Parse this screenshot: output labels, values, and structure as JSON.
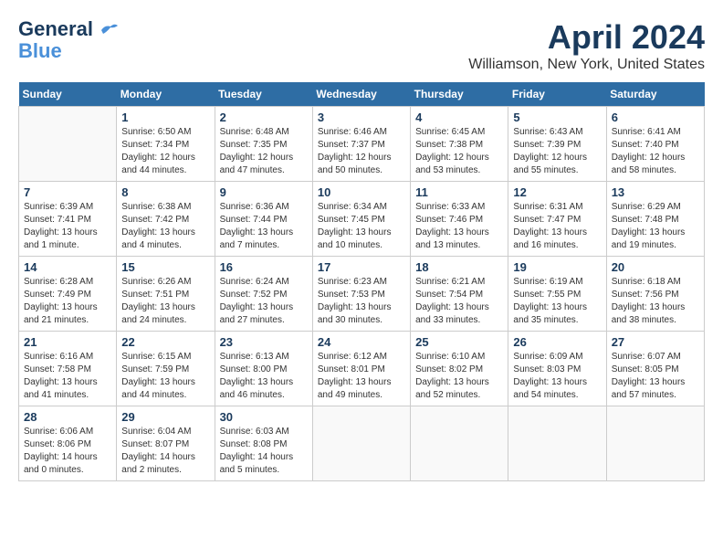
{
  "header": {
    "logo_line1": "General",
    "logo_line2": "Blue",
    "month_title": "April 2024",
    "location": "Williamson, New York, United States"
  },
  "weekdays": [
    "Sunday",
    "Monday",
    "Tuesday",
    "Wednesday",
    "Thursday",
    "Friday",
    "Saturday"
  ],
  "weeks": [
    [
      {
        "day": "",
        "info": ""
      },
      {
        "day": "1",
        "info": "Sunrise: 6:50 AM\nSunset: 7:34 PM\nDaylight: 12 hours\nand 44 minutes."
      },
      {
        "day": "2",
        "info": "Sunrise: 6:48 AM\nSunset: 7:35 PM\nDaylight: 12 hours\nand 47 minutes."
      },
      {
        "day": "3",
        "info": "Sunrise: 6:46 AM\nSunset: 7:37 PM\nDaylight: 12 hours\nand 50 minutes."
      },
      {
        "day": "4",
        "info": "Sunrise: 6:45 AM\nSunset: 7:38 PM\nDaylight: 12 hours\nand 53 minutes."
      },
      {
        "day": "5",
        "info": "Sunrise: 6:43 AM\nSunset: 7:39 PM\nDaylight: 12 hours\nand 55 minutes."
      },
      {
        "day": "6",
        "info": "Sunrise: 6:41 AM\nSunset: 7:40 PM\nDaylight: 12 hours\nand 58 minutes."
      }
    ],
    [
      {
        "day": "7",
        "info": "Sunrise: 6:39 AM\nSunset: 7:41 PM\nDaylight: 13 hours\nand 1 minute."
      },
      {
        "day": "8",
        "info": "Sunrise: 6:38 AM\nSunset: 7:42 PM\nDaylight: 13 hours\nand 4 minutes."
      },
      {
        "day": "9",
        "info": "Sunrise: 6:36 AM\nSunset: 7:44 PM\nDaylight: 13 hours\nand 7 minutes."
      },
      {
        "day": "10",
        "info": "Sunrise: 6:34 AM\nSunset: 7:45 PM\nDaylight: 13 hours\nand 10 minutes."
      },
      {
        "day": "11",
        "info": "Sunrise: 6:33 AM\nSunset: 7:46 PM\nDaylight: 13 hours\nand 13 minutes."
      },
      {
        "day": "12",
        "info": "Sunrise: 6:31 AM\nSunset: 7:47 PM\nDaylight: 13 hours\nand 16 minutes."
      },
      {
        "day": "13",
        "info": "Sunrise: 6:29 AM\nSunset: 7:48 PM\nDaylight: 13 hours\nand 19 minutes."
      }
    ],
    [
      {
        "day": "14",
        "info": "Sunrise: 6:28 AM\nSunset: 7:49 PM\nDaylight: 13 hours\nand 21 minutes."
      },
      {
        "day": "15",
        "info": "Sunrise: 6:26 AM\nSunset: 7:51 PM\nDaylight: 13 hours\nand 24 minutes."
      },
      {
        "day": "16",
        "info": "Sunrise: 6:24 AM\nSunset: 7:52 PM\nDaylight: 13 hours\nand 27 minutes."
      },
      {
        "day": "17",
        "info": "Sunrise: 6:23 AM\nSunset: 7:53 PM\nDaylight: 13 hours\nand 30 minutes."
      },
      {
        "day": "18",
        "info": "Sunrise: 6:21 AM\nSunset: 7:54 PM\nDaylight: 13 hours\nand 33 minutes."
      },
      {
        "day": "19",
        "info": "Sunrise: 6:19 AM\nSunset: 7:55 PM\nDaylight: 13 hours\nand 35 minutes."
      },
      {
        "day": "20",
        "info": "Sunrise: 6:18 AM\nSunset: 7:56 PM\nDaylight: 13 hours\nand 38 minutes."
      }
    ],
    [
      {
        "day": "21",
        "info": "Sunrise: 6:16 AM\nSunset: 7:58 PM\nDaylight: 13 hours\nand 41 minutes."
      },
      {
        "day": "22",
        "info": "Sunrise: 6:15 AM\nSunset: 7:59 PM\nDaylight: 13 hours\nand 44 minutes."
      },
      {
        "day": "23",
        "info": "Sunrise: 6:13 AM\nSunset: 8:00 PM\nDaylight: 13 hours\nand 46 minutes."
      },
      {
        "day": "24",
        "info": "Sunrise: 6:12 AM\nSunset: 8:01 PM\nDaylight: 13 hours\nand 49 minutes."
      },
      {
        "day": "25",
        "info": "Sunrise: 6:10 AM\nSunset: 8:02 PM\nDaylight: 13 hours\nand 52 minutes."
      },
      {
        "day": "26",
        "info": "Sunrise: 6:09 AM\nSunset: 8:03 PM\nDaylight: 13 hours\nand 54 minutes."
      },
      {
        "day": "27",
        "info": "Sunrise: 6:07 AM\nSunset: 8:05 PM\nDaylight: 13 hours\nand 57 minutes."
      }
    ],
    [
      {
        "day": "28",
        "info": "Sunrise: 6:06 AM\nSunset: 8:06 PM\nDaylight: 14 hours\nand 0 minutes."
      },
      {
        "day": "29",
        "info": "Sunrise: 6:04 AM\nSunset: 8:07 PM\nDaylight: 14 hours\nand 2 minutes."
      },
      {
        "day": "30",
        "info": "Sunrise: 6:03 AM\nSunset: 8:08 PM\nDaylight: 14 hours\nand 5 minutes."
      },
      {
        "day": "",
        "info": ""
      },
      {
        "day": "",
        "info": ""
      },
      {
        "day": "",
        "info": ""
      },
      {
        "day": "",
        "info": ""
      }
    ]
  ]
}
